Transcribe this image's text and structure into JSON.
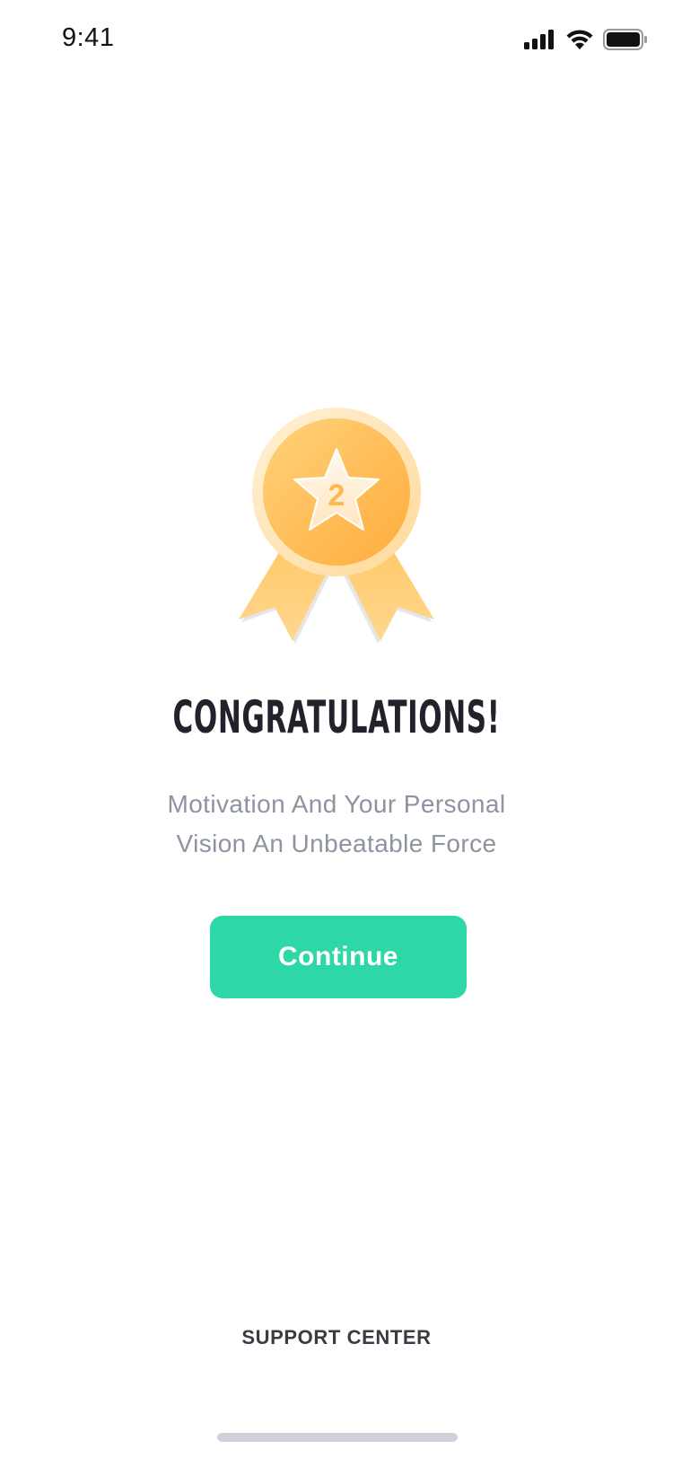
{
  "status_bar": {
    "time": "9:41",
    "icons": [
      "signal-icon",
      "wifi-icon",
      "battery-icon"
    ]
  },
  "medal": {
    "number": "2",
    "icon": "medal-icon"
  },
  "content": {
    "title": "CONGRATULATIONS!",
    "subtitle_line1": "Motivation And Your Personal",
    "subtitle_line2": "Vision An Unbeatable Force"
  },
  "actions": {
    "continue_label": "Continue",
    "support_label": "SUPPORT CENTER"
  },
  "colors": {
    "accent": "#2dd7a6",
    "medal_gold": "#ffb84d",
    "title": "#21222b",
    "subtitle": "#8d93a1"
  }
}
